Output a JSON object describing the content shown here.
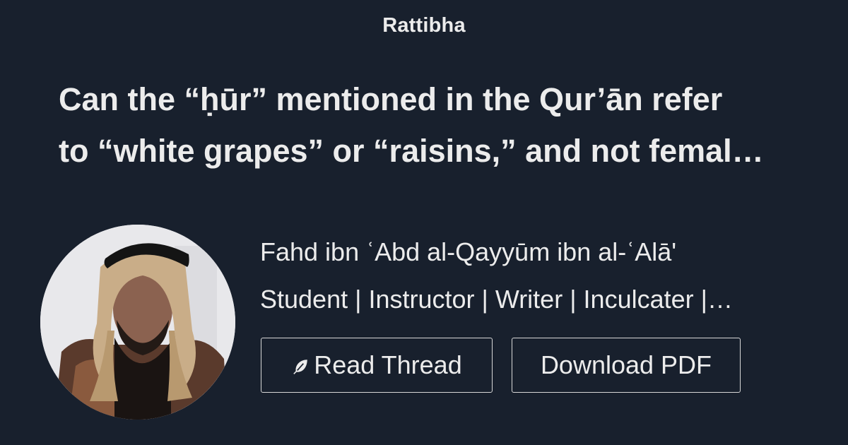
{
  "brand": "Rattibha",
  "thread": {
    "title_line1": "Can the “ḥūr” mentioned in the Qur’ān refer",
    "title_line2": "to “white grapes” or “raisins,” and not femal…"
  },
  "author": {
    "name": "Fahd ibn ʿAbd al-Qayyūm ibn al-ʿAlā'",
    "bio": "Student | Instructor | Writer | Inculcater |…"
  },
  "buttons": {
    "read_label": "Read Thread",
    "read_icon": "feather-icon",
    "pdf_label": "Download PDF"
  },
  "colors": {
    "background": "#18202d",
    "text": "#ececec",
    "button_border": "#d8d8d8"
  }
}
